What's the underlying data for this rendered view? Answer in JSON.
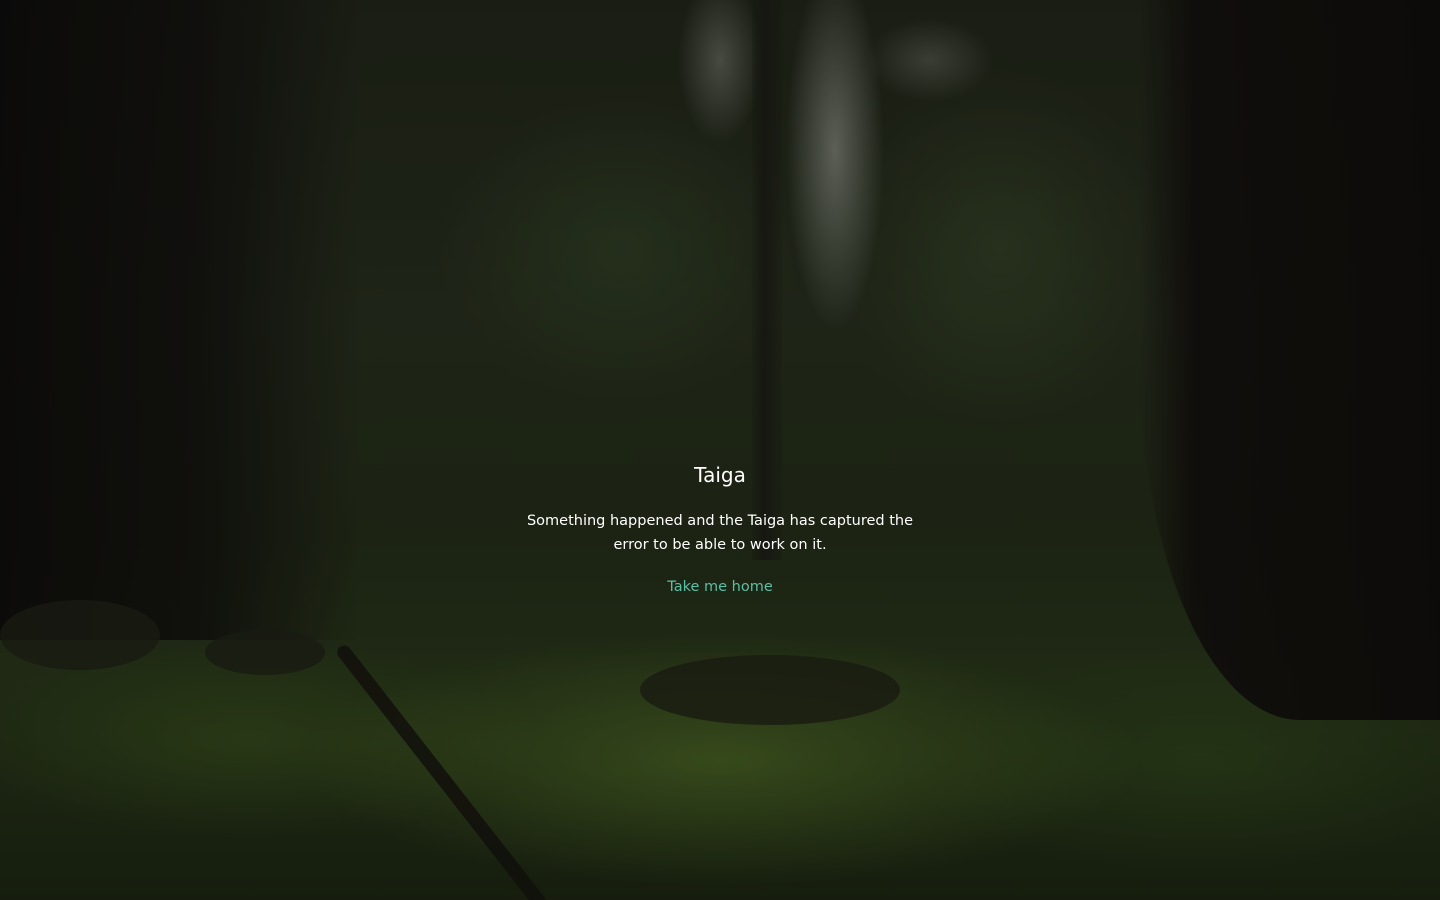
{
  "page": {
    "title": "Taiga",
    "message": "Something happened and the Taiga has captured the error to be able to work on it.",
    "home_link_label": "Take me home"
  },
  "colors": {
    "link": "#5bbfa6",
    "text": "#ffffff"
  }
}
